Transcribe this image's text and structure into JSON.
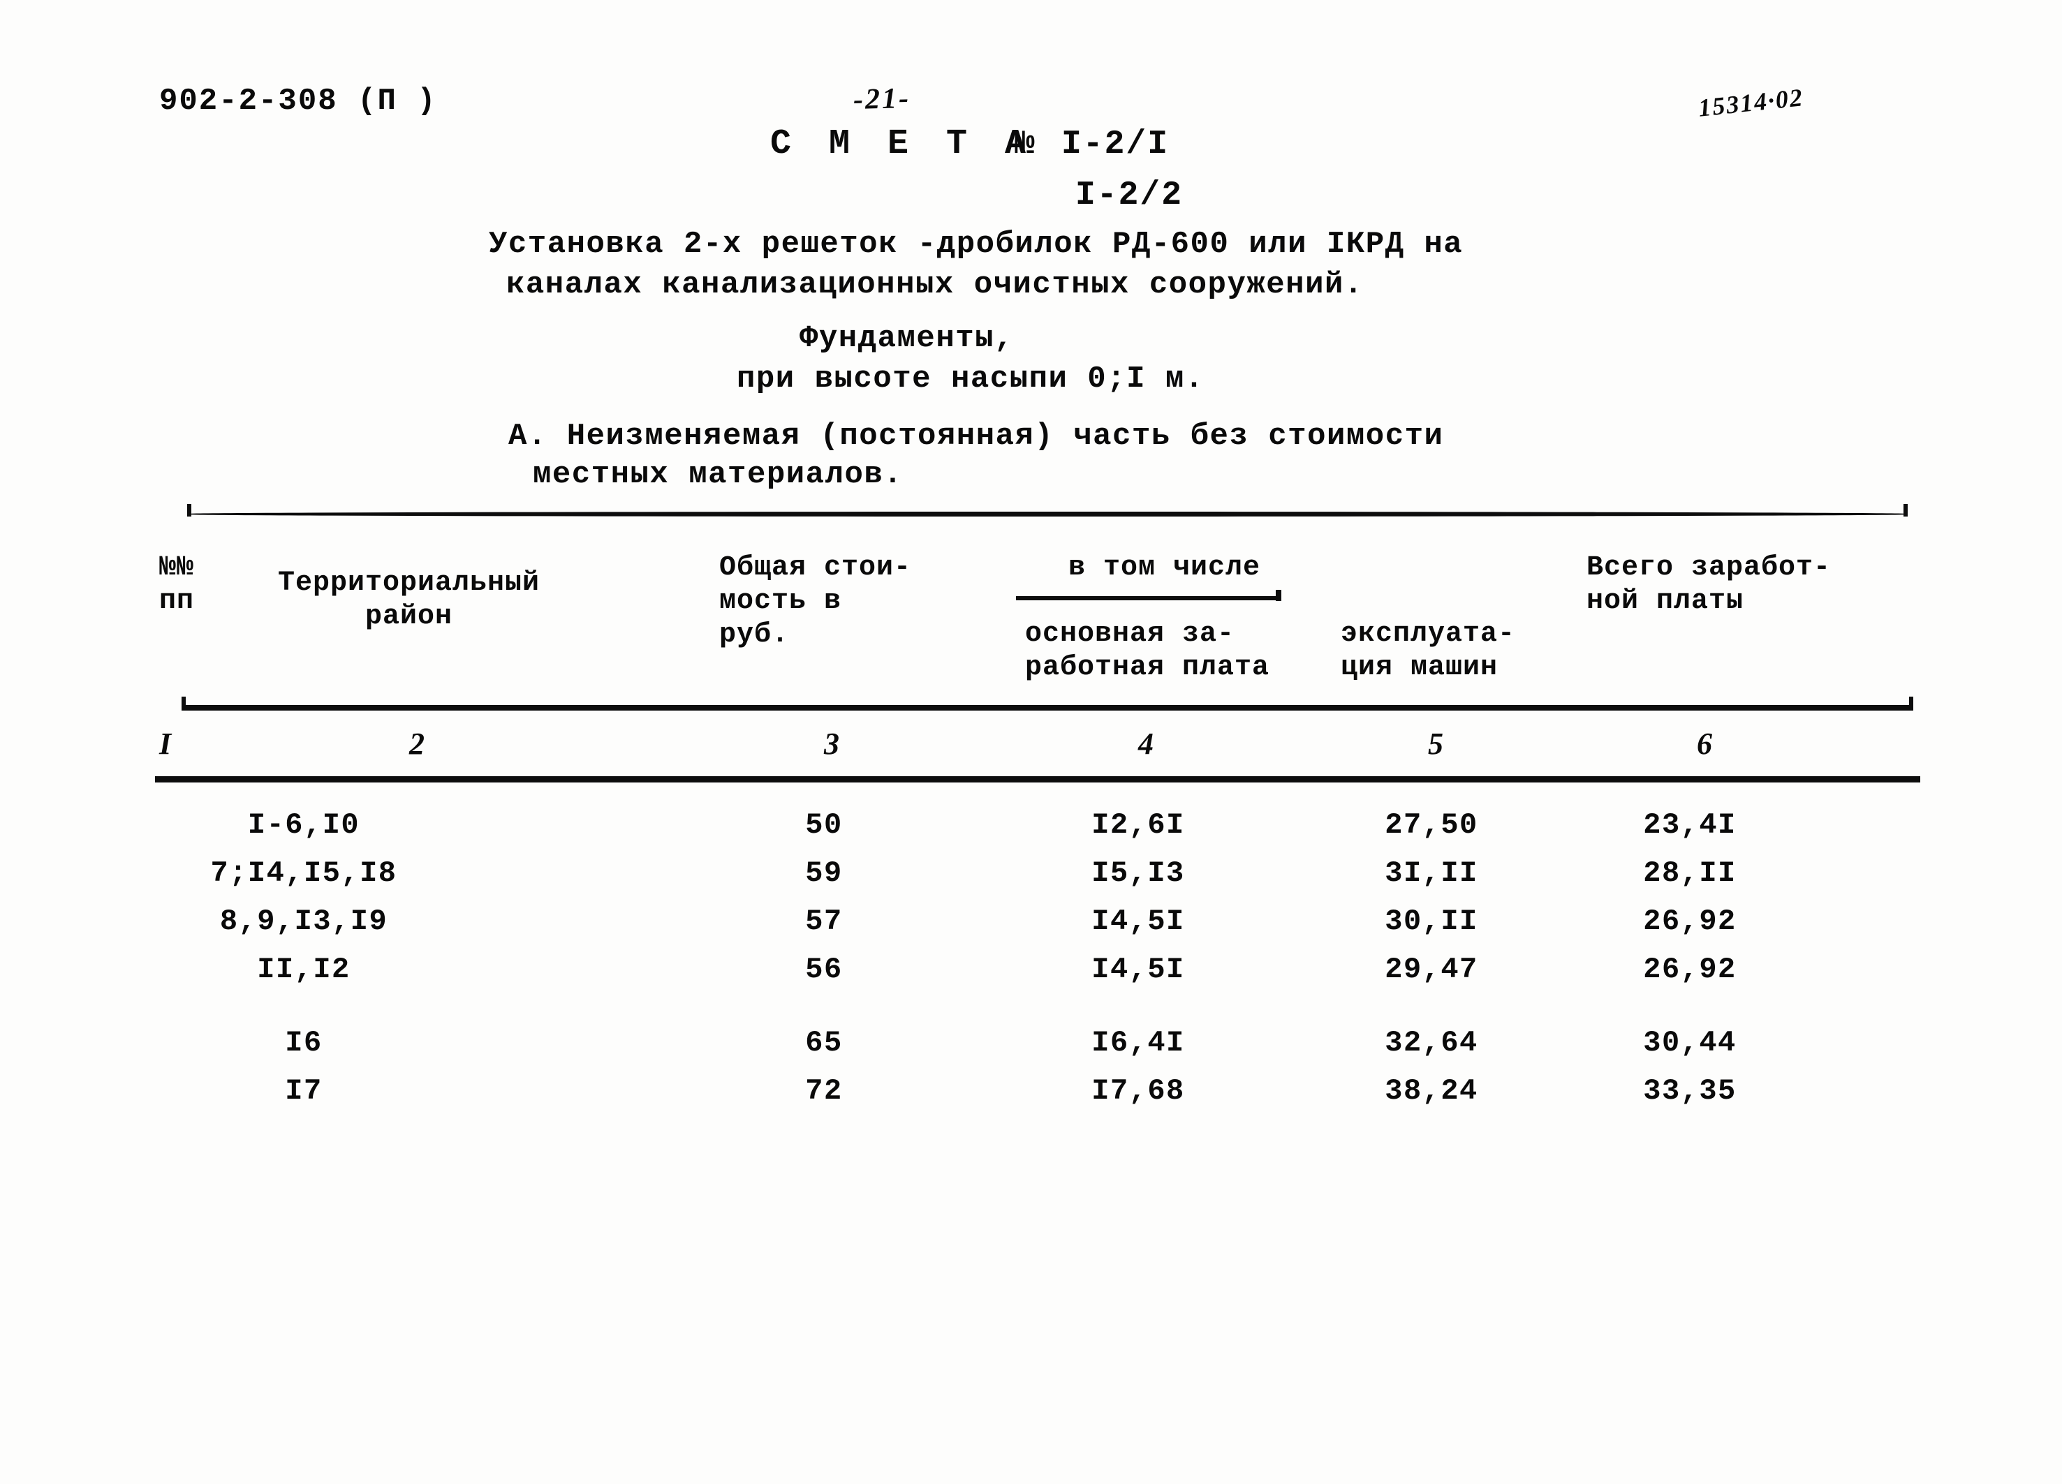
{
  "header": {
    "doc_code": "902-2-308 (П )",
    "page_number": "-21-",
    "archive_number": "15314·02",
    "smeta_label": "С М Е Т А",
    "smeta_no_symbol": "№",
    "smeta_code_1": "I-2/I",
    "smeta_code_2": "I-2/2"
  },
  "title": {
    "line1": "Установка 2-х решеток -дробилок РД-600 или IКРД на",
    "line2": "каналах канализационных очистных сооружений.",
    "subtitle1": "Фундаменты,",
    "subtitle2": "при высоте насыпи 0;I м.",
    "part_a_line1": "А. Неизменяемая (постоянная) часть без стоимости",
    "part_a_line2": "местных материалов."
  },
  "table": {
    "headers": {
      "num_line1": "№№",
      "num_line2": "пп",
      "region_line1": "Территориальный",
      "region_line2": "район",
      "total_line1": "Общая стои-",
      "total_line2": "мость в",
      "total_line3": "руб.",
      "in_which": "в том числе",
      "basic_wage_line1": "основная за-",
      "basic_wage_line2": "работная плата",
      "machines_line1": "эксплуата-",
      "machines_line2": "ция машин",
      "all_wage_line1": "Всего заработ-",
      "all_wage_line2": "ной платы"
    },
    "column_numbers": [
      "I",
      "2",
      "3",
      "4",
      "5",
      "6"
    ],
    "rows": [
      {
        "region": "I-6,I0",
        "total": "50",
        "basic_wage": "I2,6I",
        "machines": "27,50",
        "all_wage": "23,4I",
        "gap_before": false
      },
      {
        "region": "7;I4,I5,I8",
        "total": "59",
        "basic_wage": "I5,I3",
        "machines": "3I,II",
        "all_wage": "28,II",
        "gap_before": false
      },
      {
        "region": "8,9,I3,I9",
        "total": "57",
        "basic_wage": "I4,5I",
        "machines": "30,II",
        "all_wage": "26,92",
        "gap_before": false
      },
      {
        "region": "II,I2",
        "total": "56",
        "basic_wage": "I4,5I",
        "machines": "29,47",
        "all_wage": "26,92",
        "gap_before": false
      },
      {
        "region": "I6",
        "total": "65",
        "basic_wage": "I6,4I",
        "machines": "32,64",
        "all_wage": "30,44",
        "gap_before": true
      },
      {
        "region": "I7",
        "total": "72",
        "basic_wage": "I7,68",
        "machines": "38,24",
        "all_wage": "33,35",
        "gap_before": false
      }
    ]
  }
}
